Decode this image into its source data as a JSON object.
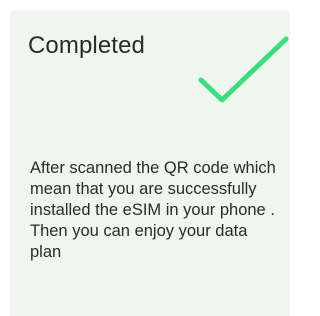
{
  "card": {
    "title": "Completed",
    "icon": "checkmark-icon",
    "icon_color": "#3ddc84",
    "background_color": "#eef6ee",
    "body": "After scanned the QR code which mean that you are successfully installed the eSIM in your phone . Then you can enjoy your data plan"
  }
}
